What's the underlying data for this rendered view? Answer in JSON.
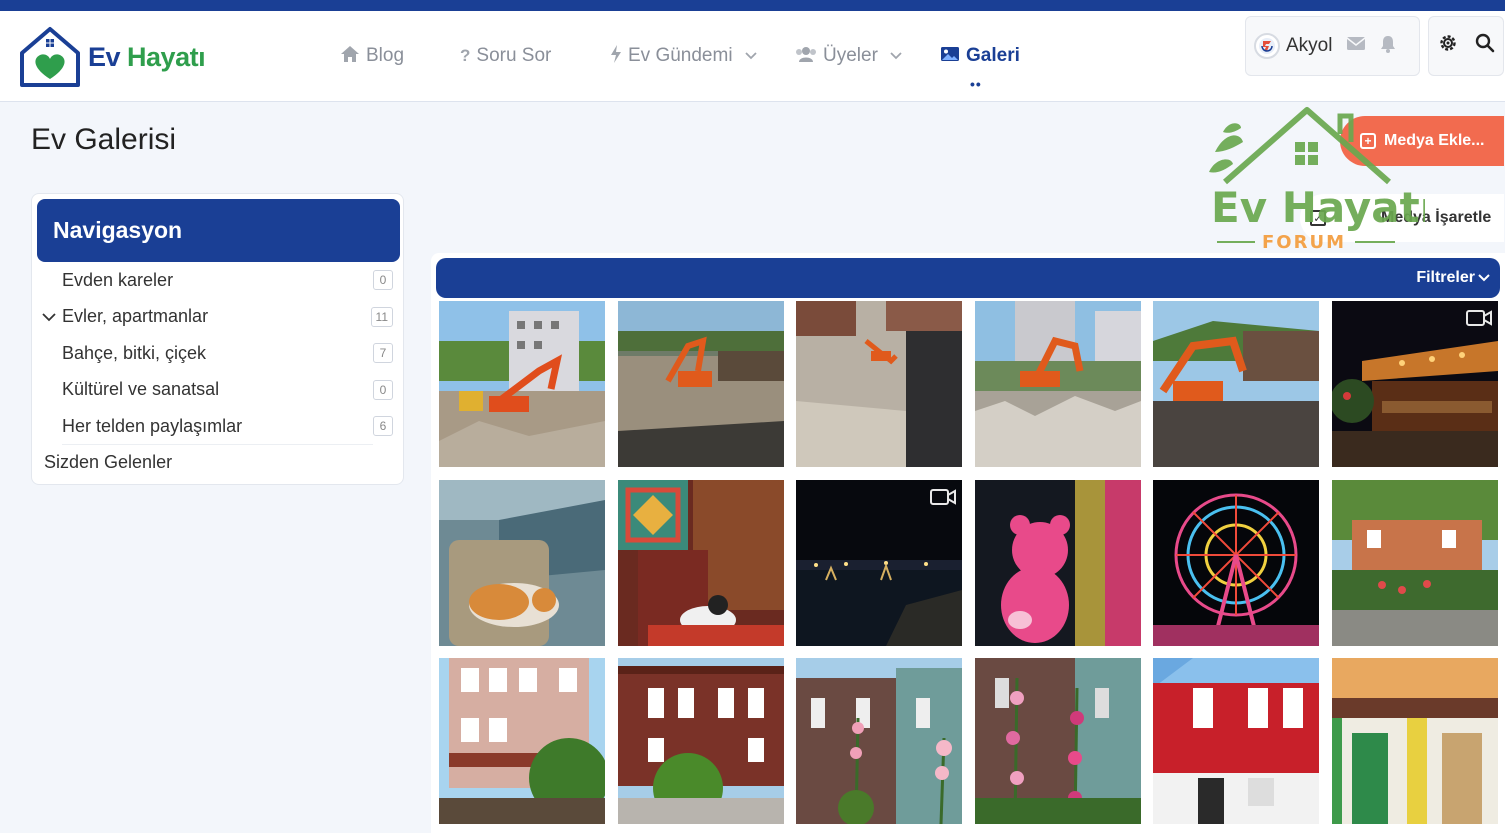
{
  "brand": {
    "word1": "Ev",
    "word2": "Hayatı",
    "primary": "#1a3f95",
    "green": "#2f9e4c",
    "accent": "#f26b4f"
  },
  "nav": [
    {
      "label": "Blog",
      "icon": "home-icon",
      "dropdown": false,
      "active": false
    },
    {
      "label": "Soru Sor",
      "icon": "question-icon",
      "dropdown": false,
      "active": false
    },
    {
      "label": "Ev Gündemi",
      "icon": "bolt-icon",
      "dropdown": true,
      "active": false
    },
    {
      "label": "Üyeler",
      "icon": "users-icon",
      "dropdown": true,
      "active": false
    },
    {
      "label": "Galeri",
      "icon": "image-icon",
      "dropdown": false,
      "active": true
    }
  ],
  "user": {
    "name": "Akyol"
  },
  "page": {
    "title": "Ev Galerisi"
  },
  "actions": {
    "add_media": "Medya Ekle...",
    "mark_media": "Medya İşaretle"
  },
  "watermark": {
    "line1": "Ev Hayatı",
    "line2": "FORUM"
  },
  "sidebar": {
    "heading": "Navigasyon",
    "items": [
      {
        "label": "Evden kareler",
        "count": "0"
      },
      {
        "label": "Evler, apartmanlar",
        "count": "11",
        "expanded": true
      },
      {
        "label": "Bahçe, bitki, çiçek",
        "count": "7"
      },
      {
        "label": "Kültürel ve sanatsal",
        "count": "0"
      },
      {
        "label": "Her telden paylaşımlar",
        "count": "6"
      }
    ],
    "extra": "Sizden Gelenler"
  },
  "filters": {
    "label": "Filtreler"
  },
  "gallery": [
    {
      "scene": "excavator-site",
      "video": false
    },
    {
      "scene": "excavator-dirt",
      "video": false
    },
    {
      "scene": "aerial-demolition",
      "video": false
    },
    {
      "scene": "excavator-rubble",
      "video": false
    },
    {
      "scene": "excavator-hill",
      "video": false
    },
    {
      "scene": "night-restaurant",
      "video": true
    },
    {
      "scene": "cat-on-chair",
      "video": false
    },
    {
      "scene": "cat-carpet",
      "video": false
    },
    {
      "scene": "night-sea",
      "video": true
    },
    {
      "scene": "pink-teddy",
      "video": false
    },
    {
      "scene": "ferris-wheel",
      "video": false
    },
    {
      "scene": "garden-house",
      "video": false
    },
    {
      "scene": "pink-wooden-house",
      "video": false
    },
    {
      "scene": "brown-wooden-house",
      "video": false
    },
    {
      "scene": "hollyhock-house-1",
      "video": false
    },
    {
      "scene": "hollyhock-house-2",
      "video": false
    },
    {
      "scene": "red-house",
      "video": false
    },
    {
      "scene": "green-doors",
      "video": false
    }
  ]
}
